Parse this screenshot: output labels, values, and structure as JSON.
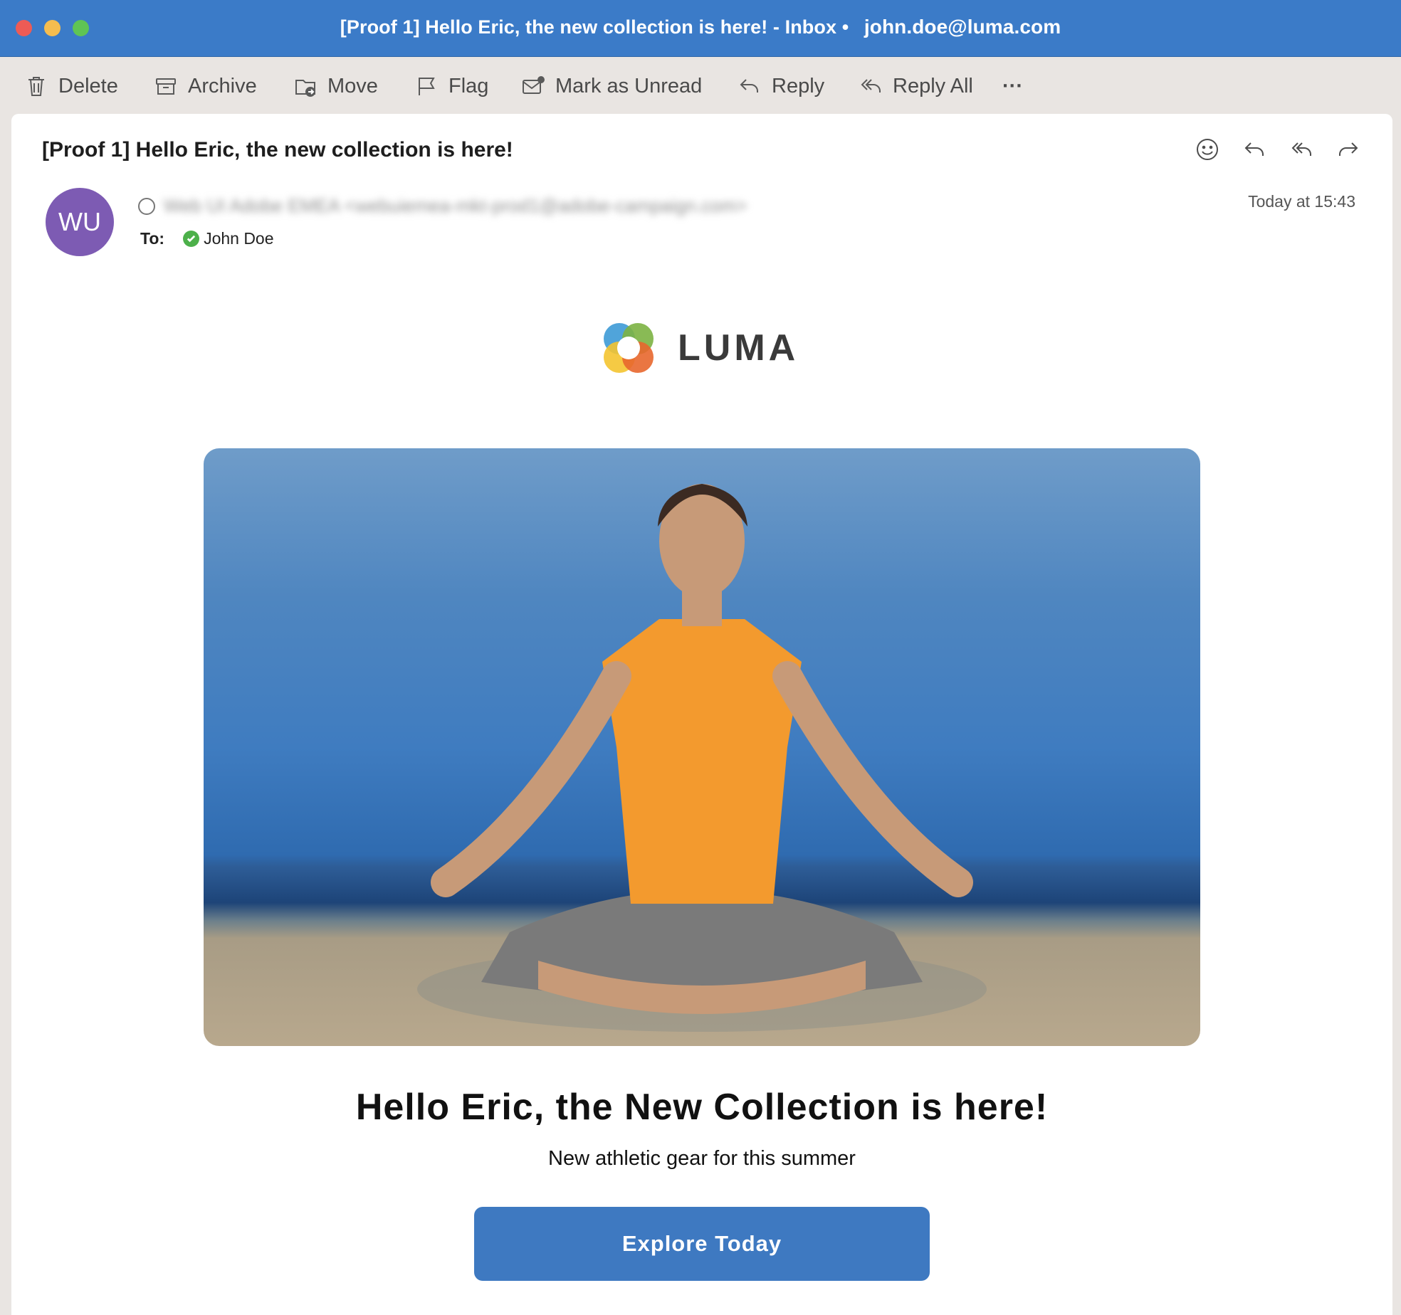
{
  "window": {
    "title": "[Proof 1] Hello Eric, the new collection is here! - Inbox •",
    "account": "john.doe@luma.com"
  },
  "toolbar": {
    "delete": "Delete",
    "archive": "Archive",
    "move": "Move",
    "flag": "Flag",
    "mark_unread": "Mark as Unread",
    "reply": "Reply",
    "reply_all": "Reply All",
    "more": "···"
  },
  "message": {
    "subject": "[Proof 1] Hello Eric, the new collection is here!",
    "avatar_initials": "WU",
    "sender": "Web UI Adobe EMEA <webuiemea-mkt-prod1@adobe-campaign.com>",
    "to_label": "To:",
    "recipient": "John Doe",
    "timestamp": "Today at 15:43"
  },
  "email_body": {
    "logo_text": "LUMA",
    "headline": "Hello Eric, the New Collection is here!",
    "subheadline": "New athletic gear for this summer",
    "cta_label": "Explore Today"
  },
  "colors": {
    "titlebar": "#3b7bc8",
    "avatar": "#7d5bb3",
    "cta": "#3e79c1",
    "check": "#4cb04a"
  },
  "icons": [
    "trash-icon",
    "archive-icon",
    "move-folder-icon",
    "flag-icon",
    "mail-unread-icon",
    "reply-icon",
    "reply-all-icon",
    "more-icon",
    "emoji-icon",
    "forward-icon",
    "check-icon"
  ]
}
